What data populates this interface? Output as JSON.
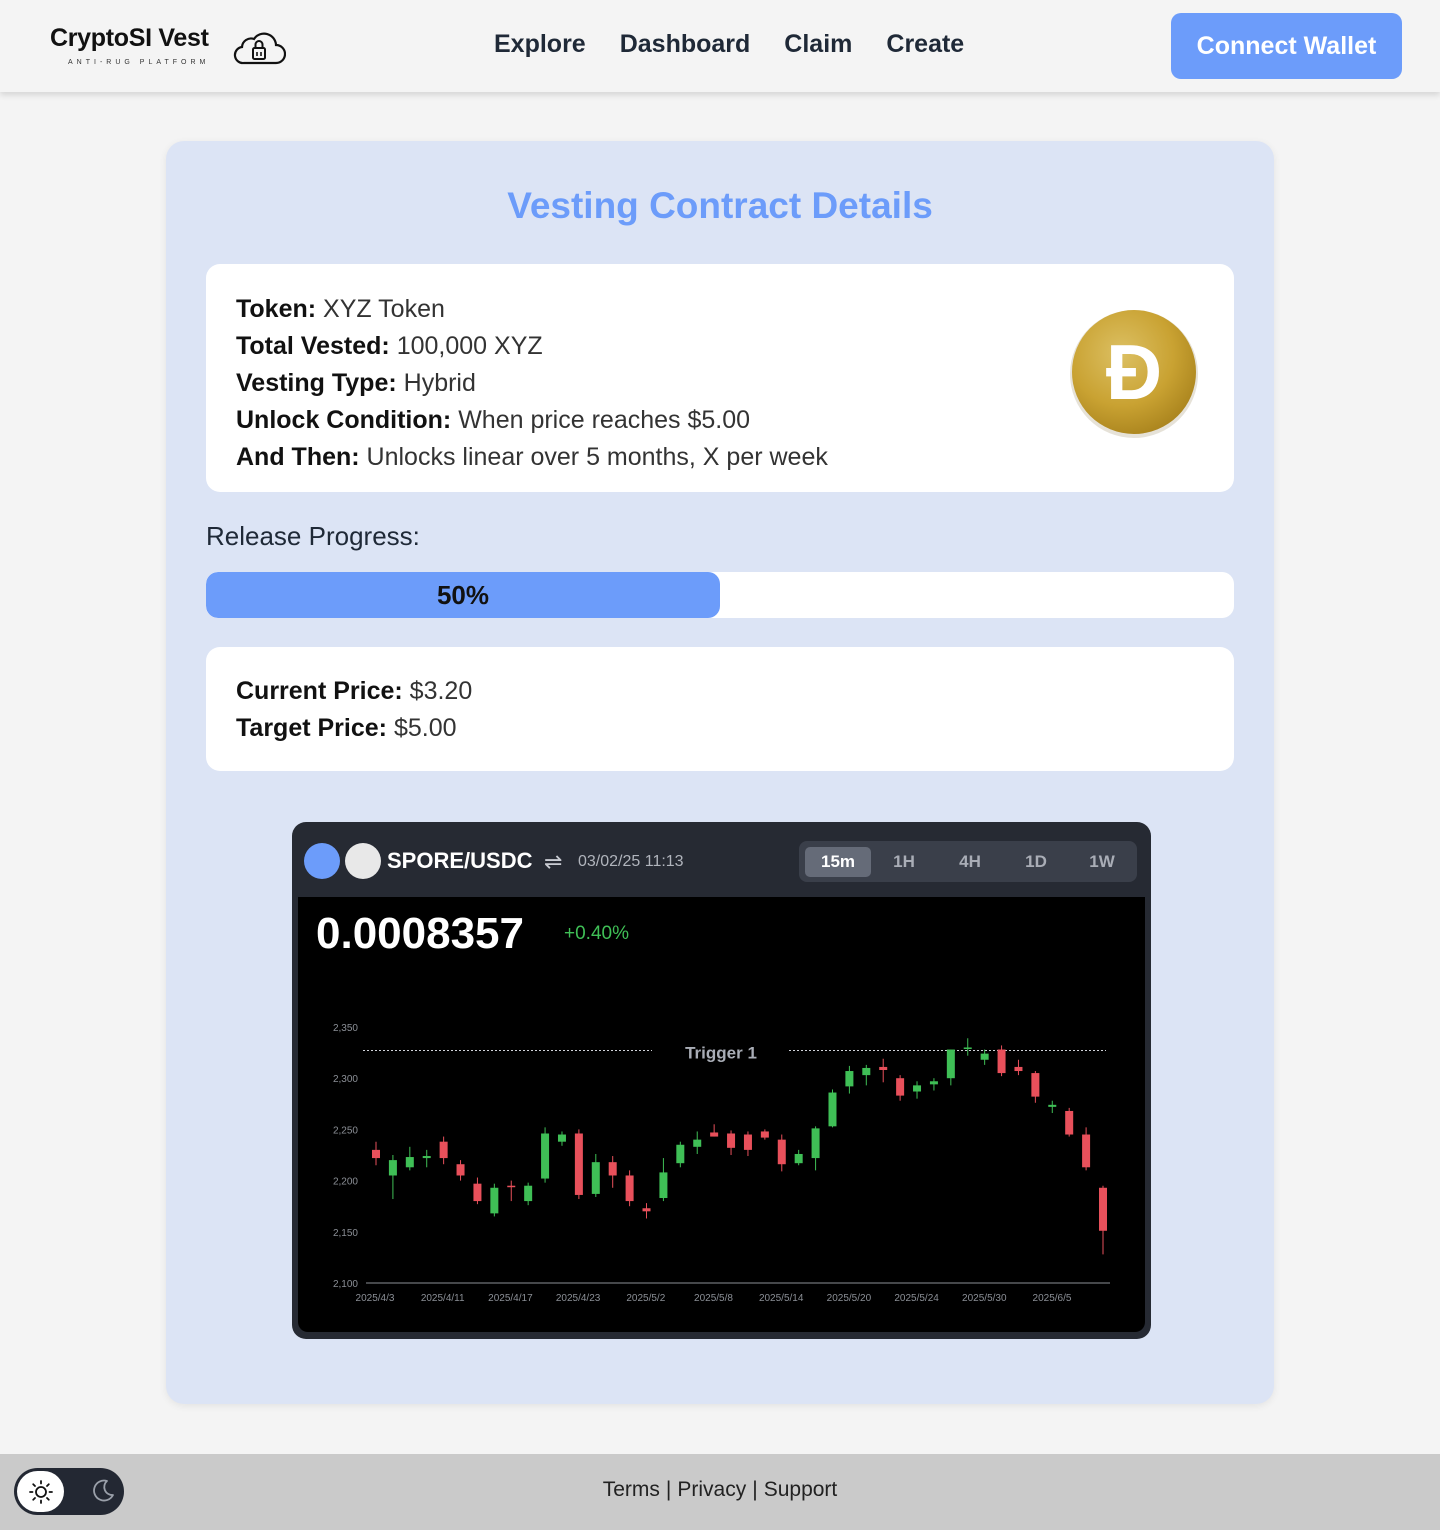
{
  "header": {
    "brand": "CryptoSI Vest",
    "tagline": "ANTI-RUG PLATFORM",
    "nav": [
      "Explore",
      "Dashboard",
      "Claim",
      "Create"
    ],
    "connect_label": "Connect Wallet"
  },
  "contract": {
    "title": "Vesting Contract Details",
    "token_label": "Token:",
    "token_value": "XYZ Token",
    "total_label": "Total Vested:",
    "total_value": "100,000 XYZ",
    "type_label": "Vesting Type:",
    "type_value": "Hybrid",
    "unlock_label": "Unlock Condition:",
    "unlock_value": "When price reaches $5.00",
    "then_label": "And Then:",
    "then_value": "Unlocks linear over 5 months, X per week",
    "coin_icon": "dogecoin-icon",
    "coin_symbol": "Ð"
  },
  "progress": {
    "label": "Release Progress:",
    "percent": 50,
    "text": "50%"
  },
  "prices": {
    "current_label": "Current Price:",
    "current_value": "$3.20",
    "target_label": "Target Price:",
    "target_value": "$5.00"
  },
  "widget": {
    "pair": "SPORE/USDC",
    "swap_icon": "swap-arrows-icon",
    "swap_symbol": "⇌",
    "datetime": "03/02/25 11:13",
    "timeframes": [
      "15m",
      "1H",
      "4H",
      "1D",
      "1W"
    ],
    "active_timeframe": "15m",
    "price": "0.0008357",
    "change": "+0.40%",
    "trigger_label": "Trigger 1"
  },
  "chart_data": {
    "type": "candlestick",
    "y_ticks": [
      "2,350",
      "2,300",
      "2,250",
      "2,200",
      "2,150",
      "2,100"
    ],
    "ylim": [
      2100,
      2350
    ],
    "x_ticks": [
      "2025/4/3",
      "2025/4/11",
      "2025/4/17",
      "2025/4/23",
      "2025/5/2",
      "2025/5/8",
      "2025/5/14",
      "2025/5/20",
      "2025/5/24",
      "2025/5/30",
      "2025/6/5"
    ],
    "trigger_value": 2327,
    "up_color": "#3fbf56",
    "down_color": "#e8505b",
    "candles": [
      [
        2230,
        2222,
        2238,
        2215
      ],
      [
        2205,
        2220,
        2225,
        2182
      ],
      [
        2213,
        2223,
        2233,
        2210
      ],
      [
        2222,
        2224,
        2230,
        2213
      ],
      [
        2238,
        2222,
        2243,
        2216
      ],
      [
        2216,
        2205,
        2220,
        2200
      ],
      [
        2197,
        2180,
        2203,
        2177
      ],
      [
        2168,
        2193,
        2197,
        2165
      ],
      [
        2195,
        2194,
        2200,
        2180
      ],
      [
        2180,
        2195,
        2198,
        2176
      ],
      [
        2202,
        2246,
        2252,
        2198
      ],
      [
        2238,
        2245,
        2248,
        2234
      ],
      [
        2246,
        2186,
        2250,
        2182
      ],
      [
        2187,
        2218,
        2226,
        2184
      ],
      [
        2218,
        2205,
        2224,
        2193
      ],
      [
        2205,
        2180,
        2210,
        2175
      ],
      [
        2173,
        2170,
        2178,
        2163
      ],
      [
        2183,
        2208,
        2222,
        2180
      ],
      [
        2217,
        2235,
        2238,
        2213
      ],
      [
        2233,
        2240,
        2248,
        2226
      ],
      [
        2247,
        2243,
        2255,
        2243
      ],
      [
        2246,
        2232,
        2249,
        2225
      ],
      [
        2245,
        2230,
        2248,
        2224
      ],
      [
        2248,
        2242,
        2250,
        2240
      ],
      [
        2240,
        2216,
        2245,
        2209
      ],
      [
        2217,
        2226,
        2230,
        2215
      ],
      [
        2222,
        2251,
        2253,
        2210
      ],
      [
        2253,
        2286,
        2289,
        2252
      ],
      [
        2292,
        2307,
        2312,
        2285
      ],
      [
        2303,
        2310,
        2313,
        2293
      ],
      [
        2311,
        2308,
        2319,
        2296
      ],
      [
        2300,
        2283,
        2303,
        2278
      ],
      [
        2287,
        2293,
        2297,
        2280
      ],
      [
        2294,
        2297,
        2300,
        2288
      ],
      [
        2300,
        2328,
        2328,
        2293
      ],
      [
        2330,
        2330,
        2339,
        2322
      ],
      [
        2318,
        2324,
        2328,
        2313
      ],
      [
        2328,
        2305,
        2332,
        2302
      ],
      [
        2311,
        2307,
        2318,
        2303
      ],
      [
        2305,
        2282,
        2307,
        2276
      ],
      [
        2272,
        2274,
        2278,
        2266
      ],
      [
        2268,
        2245,
        2271,
        2243
      ],
      [
        2245,
        2213,
        2252,
        2210
      ],
      [
        2193,
        2151,
        2195,
        2128
      ]
    ]
  },
  "footer": {
    "links": [
      "Terms",
      "Privacy",
      "Support"
    ],
    "sun_icon": "sun-icon",
    "moon_icon": "moon-icon"
  }
}
